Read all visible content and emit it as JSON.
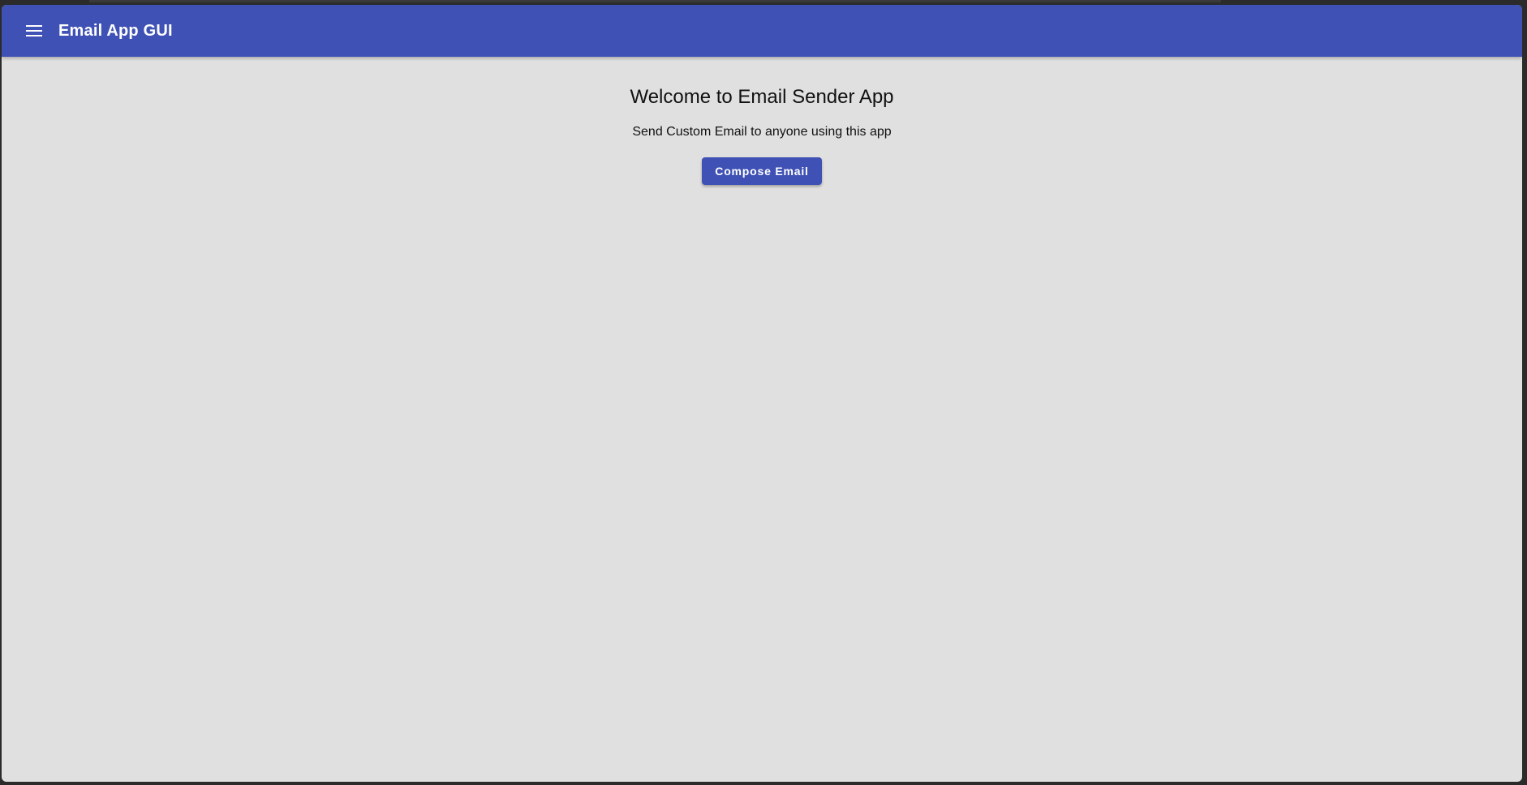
{
  "appbar": {
    "menu_icon": "hamburger-menu-icon",
    "title": "Email App GUI",
    "color": "#3f51b5"
  },
  "main": {
    "welcome": "Welcome to Email Sender App",
    "subtitle": "Send Custom Email to anyone using this app",
    "compose_label": "Compose Email"
  },
  "theme": {
    "background": "#e0e0e0",
    "primary": "#3f51b5"
  }
}
